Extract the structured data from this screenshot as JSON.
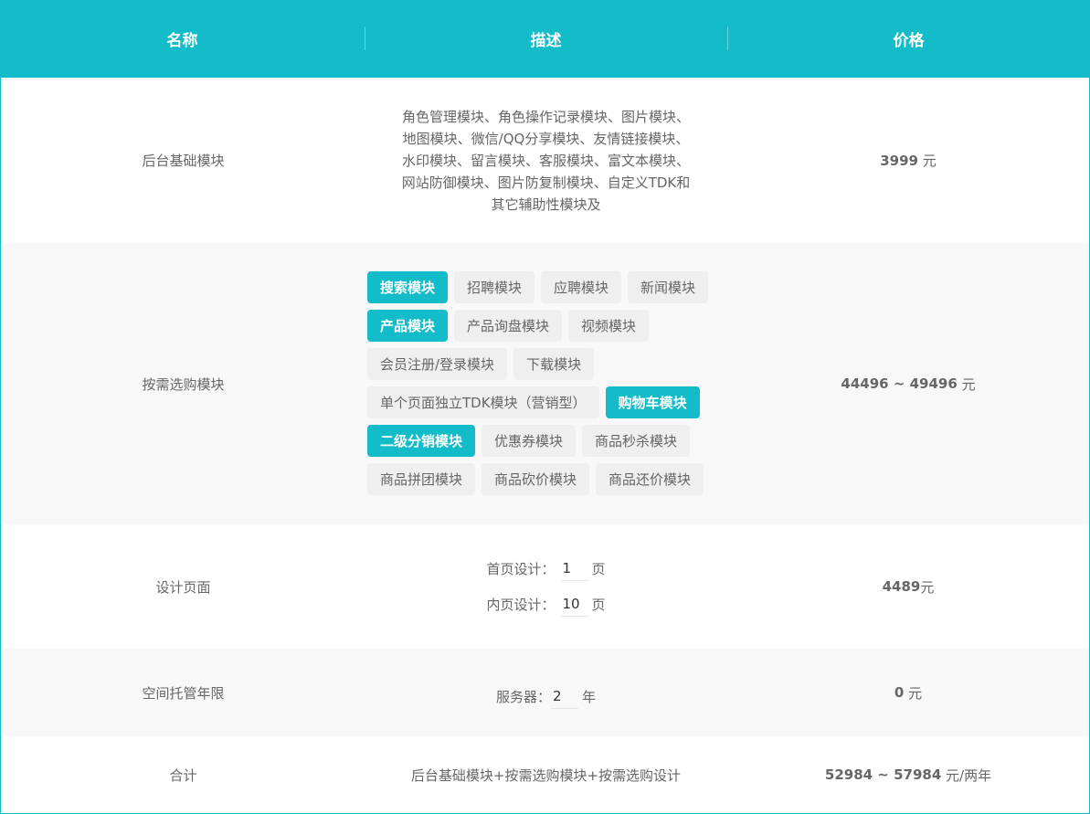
{
  "header": {
    "col_name": "名称",
    "col_desc": "描述",
    "col_price": "价格"
  },
  "rows": {
    "base": {
      "name": "后台基础模块",
      "desc_lines": [
        "角色管理模块、角色操作记录模块、图片模块、",
        "地图模块、微信/QQ分享模块、友情链接模块、",
        "水印模块、留言模块、客服模块、富文本模块、",
        "网站防御模块、图片防复制模块、自定义TDK和",
        "其它辅助性模块及"
      ],
      "price_value": "3999",
      "price_unit": " 元"
    },
    "optional": {
      "name": "按需选购模块",
      "tag_lines": [
        [
          {
            "label": "搜索模块",
            "selected": true
          },
          {
            "label": "招聘模块",
            "selected": false
          },
          {
            "label": "应聘模块",
            "selected": false
          },
          {
            "label": "新闻模块",
            "selected": false
          }
        ],
        [
          {
            "label": "产品模块",
            "selected": true
          },
          {
            "label": "产品询盘模块",
            "selected": false
          },
          {
            "label": "视频模块",
            "selected": false
          }
        ],
        [
          {
            "label": "会员注册/登录模块",
            "selected": false
          },
          {
            "label": "下载模块",
            "selected": false
          }
        ],
        [
          {
            "label": "单个页面独立TDK模块（营销型）",
            "selected": false
          },
          {
            "label": "购物车模块",
            "selected": true
          }
        ],
        [
          {
            "label": "二级分销模块",
            "selected": true
          },
          {
            "label": "优惠券模块",
            "selected": false
          },
          {
            "label": "商品秒杀模块",
            "selected": false
          }
        ],
        [
          {
            "label": "商品拼团模块",
            "selected": false
          },
          {
            "label": "商品砍价模块",
            "selected": false
          },
          {
            "label": "商品还价模块",
            "selected": false
          }
        ]
      ],
      "price_value": "44496 ~ 49496",
      "price_unit": " 元"
    },
    "design": {
      "name": "设计页面",
      "home_label": "首页设计：",
      "home_value": "1",
      "inner_label": "内页设计：",
      "inner_value": "10",
      "page_unit": "页",
      "price_value": "4489",
      "price_unit": "元"
    },
    "hosting": {
      "name": "空间托管年限",
      "server_label": "服务器：",
      "server_value": "2",
      "year_unit": "年",
      "price_value": "0",
      "price_unit": " 元"
    },
    "total": {
      "name": "合计",
      "desc": "后台基础模块+按需选购模块+按需选购设计",
      "price_value": "52984 ~ 57984",
      "price_unit": " 元/两年"
    }
  },
  "colors": {
    "accent": "#13bcc8",
    "alt_row": "#f8f8f8",
    "tag_bg": "#efefef"
  }
}
